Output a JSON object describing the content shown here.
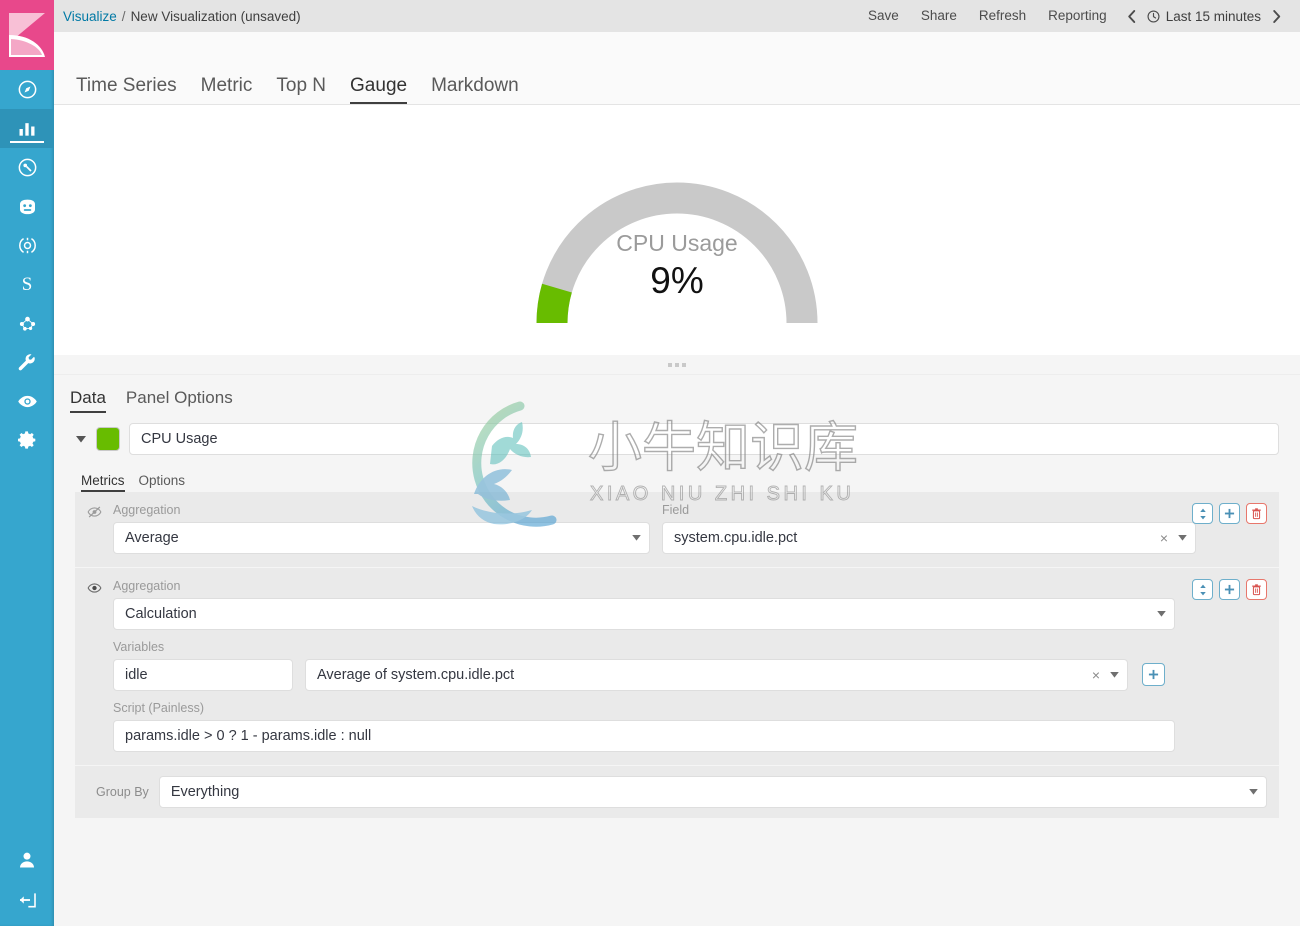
{
  "header": {
    "breadcrumb_root": "Visualize",
    "breadcrumb_sep": "/",
    "breadcrumb_current": "New Visualization (unsaved)",
    "save_label": "Save",
    "share_label": "Share",
    "refresh_label": "Refresh",
    "reporting_label": "Reporting",
    "prev_chevron": "‹",
    "next_chevron": "›",
    "clock_icon": "clock-icon",
    "time_range": "Last 15 minutes"
  },
  "vis_tabs": [
    {
      "label": "Time Series",
      "active": false
    },
    {
      "label": "Metric",
      "active": false
    },
    {
      "label": "Top N",
      "active": false
    },
    {
      "label": "Gauge",
      "active": true
    },
    {
      "label": "Markdown",
      "active": false
    }
  ],
  "sidebar": {
    "logo": "kibana-logo",
    "items": [
      {
        "name": "discover",
        "icon": "compass-icon",
        "active": false
      },
      {
        "name": "visualize",
        "icon": "bar-chart-icon",
        "active": true
      },
      {
        "name": "dashboard",
        "icon": "dashboard-icon",
        "active": false
      },
      {
        "name": "timelion",
        "icon": "timelion-icon",
        "active": false
      },
      {
        "name": "canvas",
        "icon": "canvas-icon",
        "active": false
      },
      {
        "name": "maps",
        "icon": "letter-s-icon",
        "label": "S",
        "active": false
      },
      {
        "name": "graph",
        "icon": "graph-icon",
        "active": false
      },
      {
        "name": "dev-tools",
        "icon": "wrench-icon",
        "active": false
      },
      {
        "name": "monitoring",
        "icon": "eye-icon",
        "active": false
      },
      {
        "name": "management",
        "icon": "gear-icon",
        "active": false
      }
    ],
    "bottom_items": [
      {
        "name": "user-account",
        "icon": "user-icon"
      },
      {
        "name": "logout",
        "icon": "logout-icon"
      }
    ]
  },
  "chart_data": {
    "type": "gauge",
    "title": "CPU Usage",
    "value_label": "9%",
    "value": 9,
    "min": 0,
    "max": 100,
    "unit": "%",
    "gauge_style": "half-circle",
    "start_angle_deg": 180,
    "end_angle_deg": 0,
    "fill_color": "#68BC00",
    "track_color": "#C9C9C9",
    "title_color": "#9B9B9B"
  },
  "editor": {
    "tabs": [
      {
        "label": "Data",
        "active": true
      },
      {
        "label": "Panel Options",
        "active": false
      }
    ],
    "series": {
      "collapse_caret": "▾",
      "color": "#68BC00",
      "label": "CPU Usage",
      "sub_tabs": [
        {
          "label": "Metrics",
          "active": true
        },
        {
          "label": "Options",
          "active": false
        }
      ],
      "aggregations": [
        {
          "visibility_icon": "eye-slash-icon",
          "visible": false,
          "agg_label": "Aggregation",
          "agg_value": "Average",
          "field_label": "Field",
          "field_value": "system.cpu.idle.pct",
          "clear_icon": "×",
          "actions": [
            {
              "name": "reorder-button",
              "icon": "sort-updown-icon"
            },
            {
              "name": "add-metric-button",
              "icon": "plus-icon"
            },
            {
              "name": "delete-metric-button",
              "icon": "trash-icon"
            }
          ]
        },
        {
          "visibility_icon": "eye-icon",
          "visible": true,
          "agg_label": "Aggregation",
          "agg_value": "Calculation",
          "variables_label": "Variables",
          "variable_name": "idle",
          "variable_value": "Average of system.cpu.idle.pct",
          "clear_icon": "×",
          "add_variable_icon": "plus-icon",
          "script_label": "Script (Painless)",
          "script_value": "params.idle > 0 ? 1 - params.idle : null",
          "actions": [
            {
              "name": "reorder-button",
              "icon": "sort-updown-icon"
            },
            {
              "name": "add-metric-button",
              "icon": "plus-icon"
            },
            {
              "name": "delete-metric-button",
              "icon": "trash-icon"
            }
          ]
        }
      ],
      "group_by_label": "Group By",
      "group_by_value": "Everything"
    }
  },
  "watermark": {
    "cn_text": "小牛知识库",
    "pinyin_text": "XIAO NIU ZHI SHI KU"
  }
}
